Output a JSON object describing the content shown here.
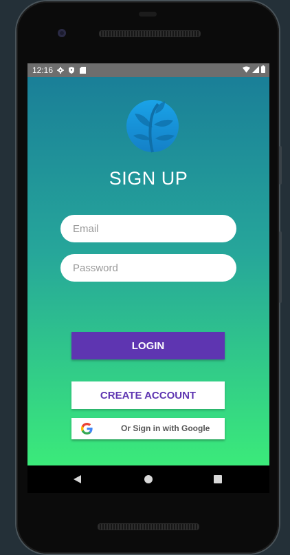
{
  "status_bar": {
    "time": "12:16",
    "left_icons": [
      "gear-icon",
      "shield-icon",
      "sd-card-icon"
    ],
    "right_icons": [
      "wifi-icon",
      "signal-icon",
      "battery-icon"
    ]
  },
  "screen": {
    "logo_icon": "leaf-logo-icon",
    "title": "SIGN UP",
    "email": {
      "placeholder": "Email",
      "value": ""
    },
    "password": {
      "placeholder": "Password",
      "value": ""
    },
    "login_label": "LOGIN",
    "create_account_label": "CREATE ACCOUNT",
    "google_label": "Or Sign in with Google"
  },
  "nav_bar": {
    "back_icon": "back-triangle-icon",
    "home_icon": "home-circle-icon",
    "recents_icon": "recents-square-icon"
  },
  "colors": {
    "gradient_top": "#1a7f98",
    "gradient_bottom": "#3bea7a",
    "login_button": "#5e35b1",
    "create_account_text": "#5e35b1",
    "status_bar": "#6e6e6e"
  }
}
